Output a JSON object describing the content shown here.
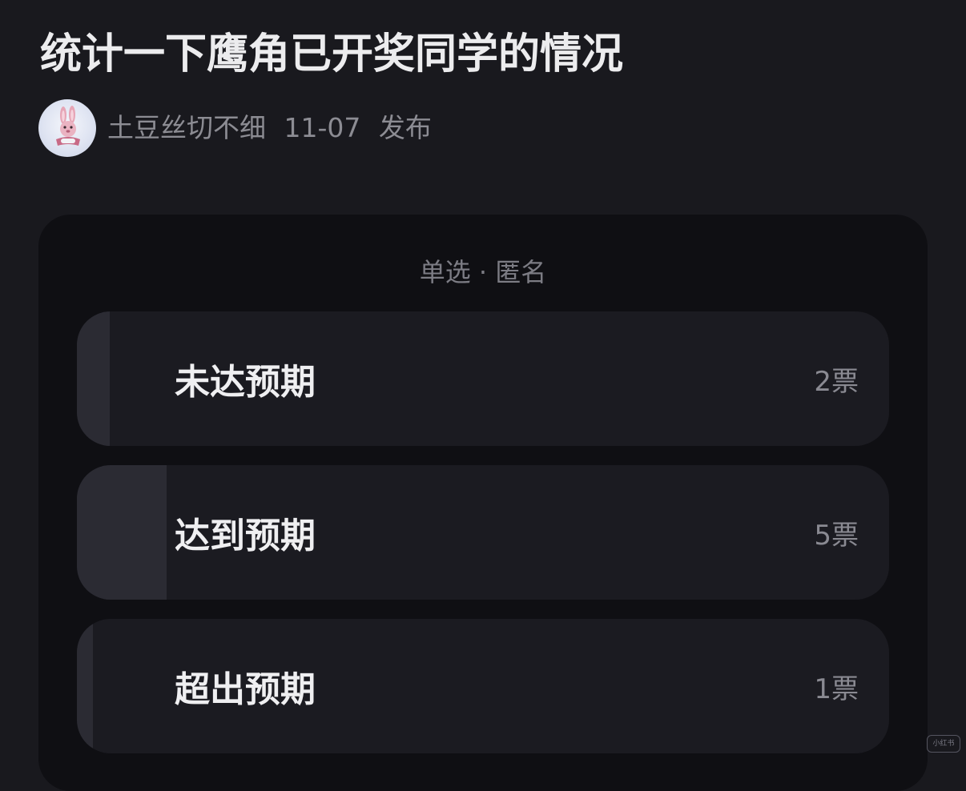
{
  "post": {
    "title": "统计一下鹰角已开奖同学的情况",
    "author": "土豆丝切不细",
    "date": "11-07",
    "action": "发布"
  },
  "poll": {
    "mode": "单选 · 匿名",
    "options": [
      {
        "label": "未达预期",
        "votes": "2票",
        "fill_fraction": 0.04
      },
      {
        "label": "达到预期",
        "votes": "5票",
        "fill_fraction": 0.11
      },
      {
        "label": "超出预期",
        "votes": "1票",
        "fill_fraction": 0.02
      }
    ]
  },
  "colors": {
    "background": "#19191e",
    "card": "#0f0f13",
    "option": "#1b1b21",
    "option_fill": "#2b2b33",
    "text_primary": "#ececee",
    "text_secondary": "#8c8c93"
  },
  "icons": {
    "avatar": "bunny-avatar-icon"
  },
  "watermark": "小红书"
}
